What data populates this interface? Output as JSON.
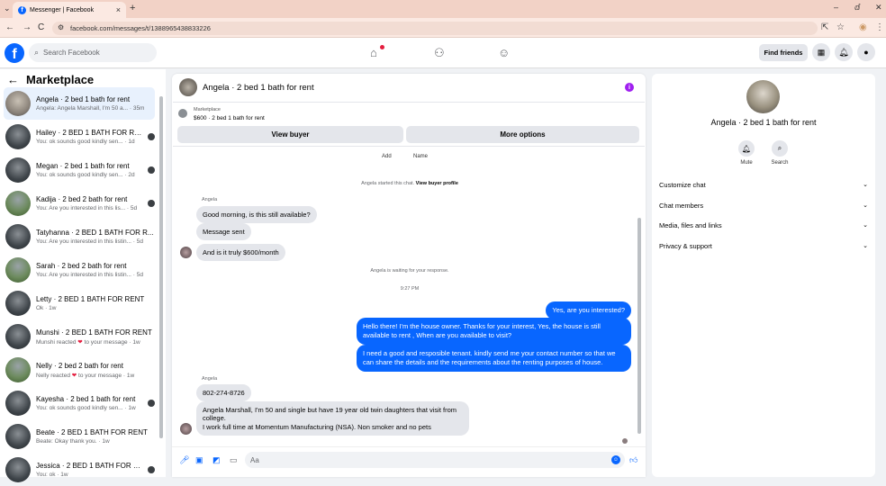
{
  "browser": {
    "tab_title": "Messenger | Facebook",
    "tab_close": "×",
    "new_tab": "+",
    "url": "facebook.com/messages/t/1388965438833226",
    "nav_back": "←",
    "nav_forward": "→",
    "nav_reload": "C",
    "win_min": "–",
    "win_max": "ⅆ",
    "win_close": "✕"
  },
  "facebook": {
    "logo": "f",
    "search_placeholder": "Search Facebook",
    "find_friends": "Find friends"
  },
  "sidebar": {
    "title": "Marketplace",
    "back_arrow": "←",
    "conversations": [
      {
        "name": "Angela · 2 bed 1 bath for rent",
        "preview": "Angela: Angela Marshall, I'm 50 a... · 35m",
        "selected": true
      },
      {
        "name": "Hailey · 2 BED 1 BATH FOR RE...",
        "preview": "You: ok sounds good kindly sen... · 1d"
      },
      {
        "name": "Megan · 2 bed 1 bath for rent",
        "preview": "You: ok sounds good kindly sen... · 2d"
      },
      {
        "name": "Kadija · 2 bed 2 bath for rent",
        "preview": "You: Are you interested in this lis... · 5d"
      },
      {
        "name": "Tatyhanna · 2 BED 1 BATH FOR R...",
        "preview": "You: Are you interested in this listin... · 5d"
      },
      {
        "name": "Sarah · 2 bed 2 bath for rent",
        "preview": "You: Are you interested in this listin... · 5d"
      },
      {
        "name": "Letty · 2 BED 1 BATH FOR RENT",
        "preview": "Ok · 1w"
      },
      {
        "name": "Munshi · 2 BED 1 BATH FOR RENT",
        "preview": "Munshi reacted ❤ to your message · 1w"
      },
      {
        "name": "Nelly · 2 bed 2 bath for rent",
        "preview": "Nelly reacted ❤ to your message · 1w"
      },
      {
        "name": "Kayesha · 2 bed 1 bath for rent",
        "preview": "You: ok sounds good kindly sen... · 1w"
      },
      {
        "name": "Beate · 2 BED 1 BATH FOR RENT",
        "preview": "Beate: Okay thank you. · 1w"
      },
      {
        "name": "Jessica · 2 BED 1 BATH FOR RE...",
        "preview": "You: ok · 1w"
      }
    ]
  },
  "chat": {
    "title": "Angela · 2 bed 1 bath for rent",
    "marketplace_label": "Marketplace",
    "listing": "$600 · 2 bed 1 bath for rent",
    "view_buyer": "View buyer",
    "more_options": "More options",
    "add_label": "Add",
    "name_label": "Name",
    "started_text": "Angela started this chat.",
    "view_buyer_profile": "View buyer profile",
    "sender_name": "Angela",
    "msg1": "Good morning, is this still available?",
    "msg2": "Message sent",
    "msg3": "And is it truly $600/month",
    "waiting": "Angela is waiting for your response.",
    "time": "9:27 PM",
    "out1": "Yes, are you interested?",
    "out2": "Hello there! I'm the house owner. Thanks for your interest, Yes, the house is still available to rent , When are you available to visit?",
    "out3": "I need a good and resposible tenant.  kindly send me your contact number so that we can share the details and the requirements about the renting purposes of house.",
    "msg4": "802-274-8726",
    "msg5": "Angela Marshall, I'm 50 and single but have 19 year old twin daughters that visit from college.\nI work full time at Momentum Manufacturing (NSA). Non smoker and no pets",
    "composer_placeholder": "Aa"
  },
  "right_panel": {
    "name": "Angela · 2 bed 1 bath for rent",
    "mute": "Mute",
    "search": "Search",
    "items": [
      "Customize chat",
      "Chat members",
      "Media, files and links",
      "Privacy & support"
    ]
  },
  "colors": {
    "accent": "#0866ff",
    "tabbar": "#f2d2c6",
    "info": "#a020f0"
  }
}
